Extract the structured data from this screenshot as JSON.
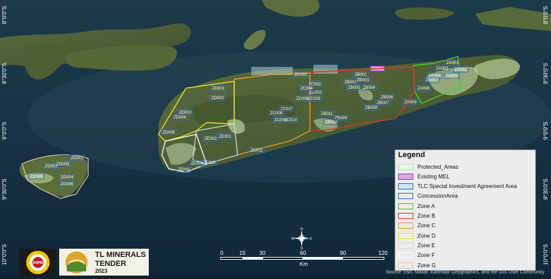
{
  "latitude_labels": [
    "8°0'0\"S",
    "8°30'0\"S",
    "9°0'0\"S",
    "9°30'0\"S",
    "10°0'0\"S"
  ],
  "legend": {
    "title": "Legend",
    "items": [
      {
        "label": "Protected_Areas",
        "fill": "#e9f6df",
        "stroke": "#c7dcbd"
      },
      {
        "label": "Existing MEL",
        "fill": "#d7a9e6",
        "stroke": "#8e3fb0"
      },
      {
        "label": "TLC Special Investment Agreement Area",
        "fill": "#cfe6f5",
        "stroke": "#2a6db5"
      },
      {
        "label": "ConcessionArea",
        "fill": "none",
        "stroke": "#2f6fd0"
      },
      {
        "label": "Zone A",
        "fill": "none",
        "stroke": "#3bd02a"
      },
      {
        "label": "Zone B",
        "fill": "none",
        "stroke": "#d23a2a"
      },
      {
        "label": "Zone C",
        "fill": "none",
        "stroke": "#e59a2a"
      },
      {
        "label": "Zone D",
        "fill": "none",
        "stroke": "#e8e02a"
      },
      {
        "label": "Zone E",
        "fill": "none",
        "stroke": "#c9d7ea"
      },
      {
        "label": "Zone F",
        "fill": "none",
        "stroke": "#ffffff"
      },
      {
        "label": "Zone G",
        "fill": "none",
        "stroke": "#e8c9a0"
      }
    ]
  },
  "scale": {
    "ticks": [
      "0",
      "15",
      "30",
      "60",
      "90",
      "120"
    ],
    "unit": "Km"
  },
  "compass": {
    "n": "N",
    "s": "S",
    "e": "E",
    "w": "W"
  },
  "logos": {
    "anpm_text": "ANPM",
    "tender_line1": "TL MINERALS",
    "tender_line2": "TENDER",
    "tender_year": "2023"
  },
  "attribution": "Source: Esri, Maxar, Earthstar Geographics, and the GIS User Community",
  "concessions": [
    {
      "id": "ZA001"
    },
    {
      "id": "ZA002"
    },
    {
      "id": "ZA003"
    },
    {
      "id": "ZA005"
    },
    {
      "id": "ZA006"
    },
    {
      "id": "ZA007"
    },
    {
      "id": "ZA008"
    },
    {
      "id": "ZA009"
    },
    {
      "id": "ZB001"
    },
    {
      "id": "ZB002"
    },
    {
      "id": "ZB003"
    },
    {
      "id": "ZB004"
    },
    {
      "id": "ZB005"
    },
    {
      "id": "ZB006"
    },
    {
      "id": "ZB007"
    },
    {
      "id": "ZB008"
    },
    {
      "id": "ZB009"
    },
    {
      "id": "ZB010"
    },
    {
      "id": "ZB011"
    },
    {
      "id": "ZC001"
    },
    {
      "id": "ZC002"
    },
    {
      "id": "ZC003"
    },
    {
      "id": "ZC004"
    },
    {
      "id": "ZC005"
    },
    {
      "id": "ZC006"
    },
    {
      "id": "ZC007"
    },
    {
      "id": "ZC008"
    },
    {
      "id": "ZC009"
    },
    {
      "id": "ZC010"
    },
    {
      "id": "ZC011"
    },
    {
      "id": "ZD001"
    },
    {
      "id": "ZD002"
    },
    {
      "id": "ZD003"
    },
    {
      "id": "ZD004"
    },
    {
      "id": "ZD005"
    },
    {
      "id": "ZE001"
    },
    {
      "id": "ZE002"
    },
    {
      "id": "ZE003"
    },
    {
      "id": "ZE004"
    },
    {
      "id": "ZE005"
    },
    {
      "id": "ZG001"
    },
    {
      "id": "ZG002"
    },
    {
      "id": "ZG003"
    },
    {
      "id": "ZG004"
    },
    {
      "id": "ZG005"
    },
    {
      "id": "ZG006"
    }
  ]
}
